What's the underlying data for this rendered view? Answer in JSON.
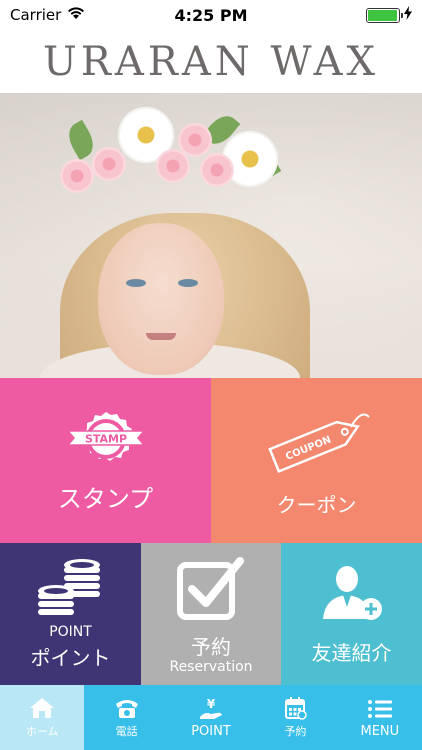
{
  "status_bar": {
    "carrier": "Carrier",
    "time": "4:25 PM",
    "battery_percent": 95
  },
  "header": {
    "logo": "URARAN WAX"
  },
  "tiles": {
    "stamp": {
      "badge_text": "STAMP",
      "label": "スタンプ"
    },
    "coupon": {
      "tag_text": "COUPON",
      "label": "クーポン"
    },
    "point": {
      "label_en": "POINT",
      "label": "ポイント"
    },
    "reservation": {
      "label": "予約",
      "label_en": "Reservation"
    },
    "friend": {
      "label": "友達紹介"
    }
  },
  "tab_bar": {
    "items": [
      {
        "label": "ホーム",
        "icon": "home-icon",
        "active": true
      },
      {
        "label": "電話",
        "icon": "phone-icon",
        "active": false
      },
      {
        "label": "POINT",
        "icon": "yen-hand-icon",
        "active": false
      },
      {
        "label": "予約",
        "icon": "calendar-icon",
        "active": false
      },
      {
        "label": "MENU",
        "icon": "menu-icon",
        "active": false
      }
    ]
  },
  "colors": {
    "stamp": "#ee5ba3",
    "coupon": "#f4886f",
    "point": "#3f3574",
    "reservation": "#b0b0b0",
    "friend": "#4ebfd0",
    "tab_bar": "#38bfe9",
    "tab_active": "#b9e7f6"
  }
}
